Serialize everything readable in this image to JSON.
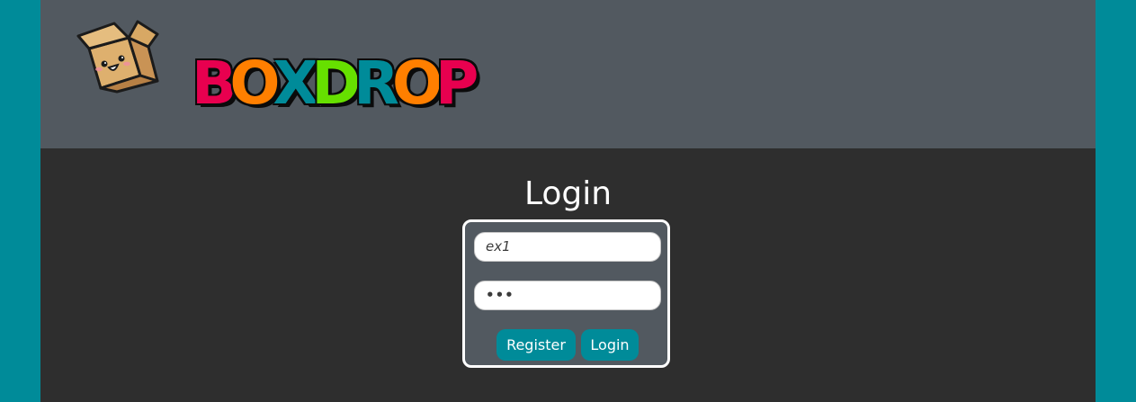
{
  "header": {
    "logo_text": "BOXDROP",
    "wordmark_letters": [
      {
        "char": "B",
        "color": "#e8004f"
      },
      {
        "char": "O",
        "color": "#ff7f00"
      },
      {
        "char": "X",
        "color": "#008b99"
      },
      {
        "char": "D",
        "color": "#66e000"
      },
      {
        "char": "R",
        "color": "#008b99"
      },
      {
        "char": "O",
        "color": "#ff7f00"
      },
      {
        "char": "P",
        "color": "#e8004f"
      }
    ]
  },
  "main": {
    "title": "Login",
    "form": {
      "username_value": "ex1",
      "password_value": "•••",
      "register_label": "Register",
      "login_label": "Login"
    }
  },
  "colors": {
    "accent": "#008b99",
    "background": "#2e2e2e",
    "header": "#525960",
    "box_tan": "#d8a864"
  },
  "icons": {
    "logo_mascot": "cardboard-box-mascot-icon"
  }
}
